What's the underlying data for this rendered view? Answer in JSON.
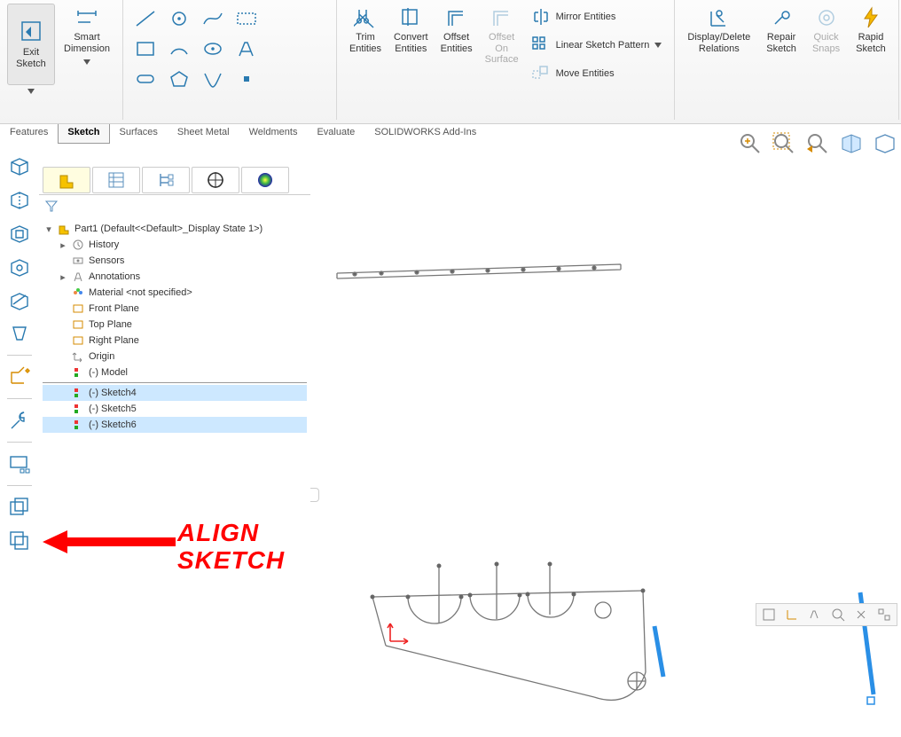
{
  "ribbon": {
    "exit": "Exit\nSketch",
    "smartdim": "Smart\nDimension",
    "trim": "Trim\nEntities",
    "convert": "Convert\nEntities",
    "offset": "Offset\nEntities",
    "offset_surf": "Offset\nOn\nSurface",
    "mirror": "Mirror Entities",
    "pattern": "Linear Sketch Pattern",
    "move": "Move Entities",
    "disprel": "Display/Delete\nRelations",
    "repair": "Repair\nSketch",
    "quicksnaps": "Quick\nSnaps",
    "rapid": "Rapid\nSketch"
  },
  "tabs": [
    "Features",
    "Sketch",
    "Surfaces",
    "Sheet Metal",
    "Weldments",
    "Evaluate",
    "SOLIDWORKS Add-Ins"
  ],
  "activeTab": "Sketch",
  "tree": {
    "root": "Part1  (Default<<Default>_Display State 1>)",
    "history": "History",
    "sensors": "Sensors",
    "annotations": "Annotations",
    "material": "Material <not specified>",
    "front": "Front Plane",
    "top": "Top Plane",
    "right": "Right Plane",
    "origin": "Origin",
    "model": "(-) Model",
    "sk4": "(-) Sketch4",
    "sk5": "(-) Sketch5",
    "sk6": "(-) Sketch6"
  },
  "annotation": {
    "line1": "ALIGN",
    "line2": "SKETCH"
  }
}
